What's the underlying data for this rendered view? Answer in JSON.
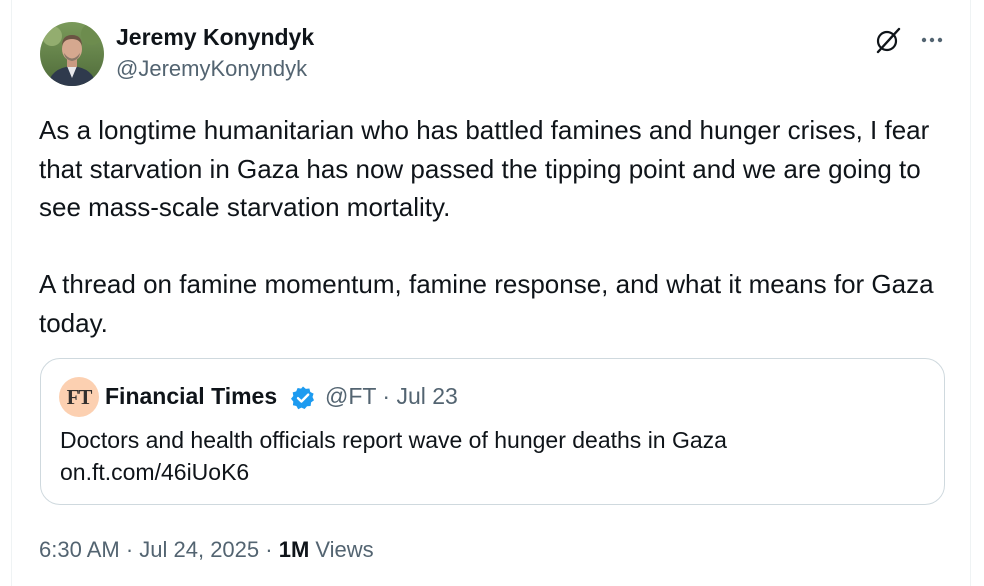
{
  "author": {
    "display_name": "Jeremy Konyndyk",
    "handle": "@JeremyKonyndyk",
    "avatar_icon": "profile-photo"
  },
  "header_actions": {
    "grok_icon": "slashed-circle-icon",
    "more_icon": "ellipsis-icon"
  },
  "tweet": {
    "text": "As a longtime humanitarian who has battled famines and hunger crises, I fear that starvation in Gaza has now passed the tipping point and we are going to see mass-scale starvation mortality.\n\nA thread on famine momentum, famine response, and what it means for Gaza today."
  },
  "quoted_tweet": {
    "logo_text": "FT",
    "display_name": "Financial Times",
    "verified_color": "#1d9bf0",
    "meta": "@FT · Jul 23",
    "text_line1": "Doctors and health officials report wave of hunger deaths in Gaza",
    "text_line2": "on.ft.com/46iUoK6"
  },
  "footer": {
    "timestamp": "6:30 AM · Jul 24, 2025 · ",
    "views_count": "1M",
    "views_label": " Views"
  }
}
